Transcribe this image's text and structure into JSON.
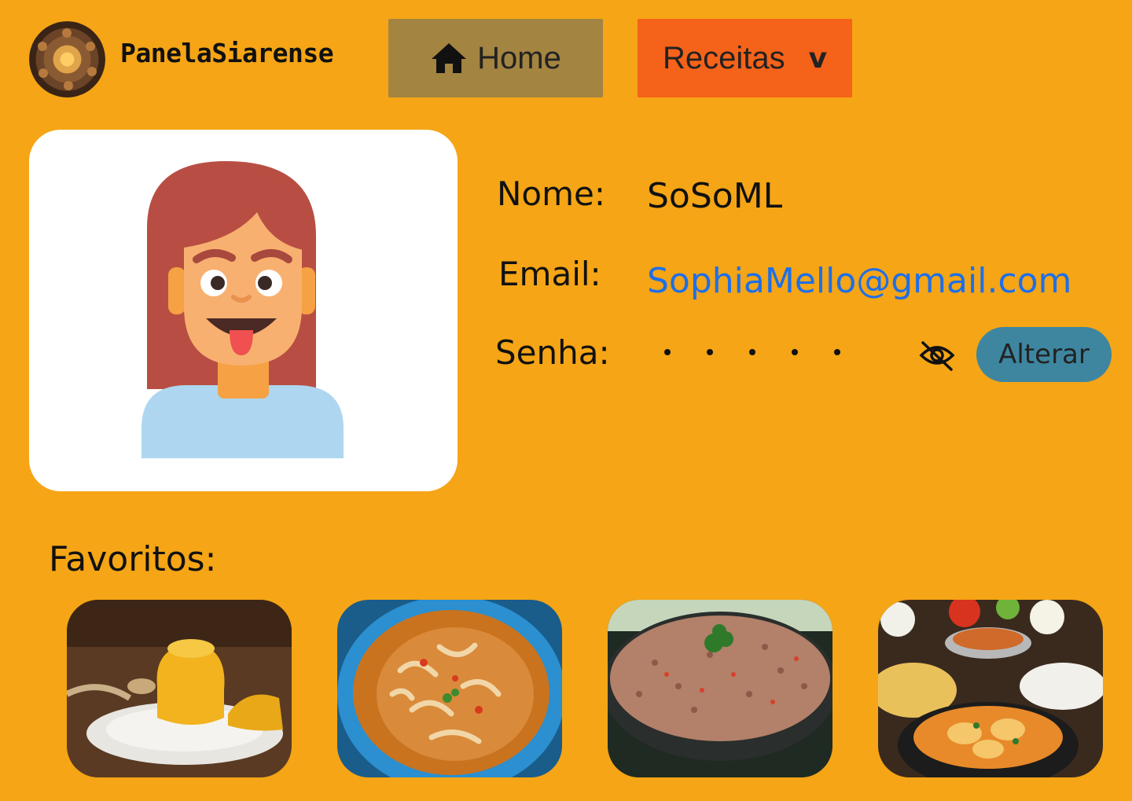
{
  "header": {
    "brand": "PanelaSiarense",
    "logo_icon": "decorative-plate-logo",
    "nav": {
      "home_label": "Home",
      "home_icon": "home-icon",
      "recipes_label": "Receitas",
      "recipes_chevron": "v"
    }
  },
  "profile": {
    "name_label": "Nome:",
    "name_value": "SoSoML",
    "email_label": "Email:",
    "email_value": "SophiaMello@gmail.com",
    "password_label": "Senha:",
    "password_mask_count": 5,
    "eye_icon": "eye-slash-icon",
    "change_button": "Alterar"
  },
  "favorites": {
    "title": "Favoritos:",
    "items": [
      "cuscuz",
      "panelada",
      "baião",
      "peixada"
    ]
  },
  "colors": {
    "background": "#F5A515",
    "home_button": "#A38441",
    "recipes_button": "#F56219",
    "change_button": "#3E86A0",
    "email_link": "#1E6FE8"
  }
}
